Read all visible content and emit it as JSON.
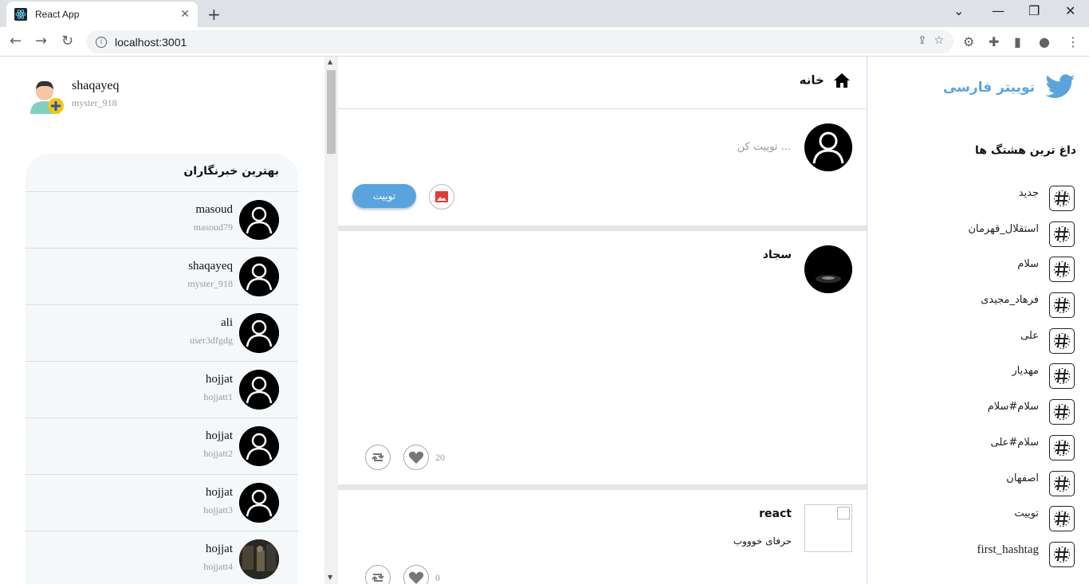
{
  "browser": {
    "tab_title": "React App",
    "url": "localhost:3001"
  },
  "left": {
    "me": {
      "name": "shaqayeq",
      "handle": "myster_918"
    },
    "influencers_title": "بهترین خبرنگاران",
    "influencers": [
      {
        "name": "masoud",
        "handle": "masoud79"
      },
      {
        "name": "shaqayeq",
        "handle": "myster_918"
      },
      {
        "name": "ali",
        "handle": "user3dfgdg"
      },
      {
        "name": "hojjat",
        "handle": "hojjatt1"
      },
      {
        "name": "hojjat",
        "handle": "hojjatt2"
      },
      {
        "name": "hojjat",
        "handle": "hojjatt3"
      },
      {
        "name": "hojjat",
        "handle": "hojjatt4"
      }
    ]
  },
  "center": {
    "home_title": "خانه",
    "compose": {
      "placeholder": "توییت کن ...",
      "tweet_button": "توییت"
    },
    "posts": [
      {
        "author": "سجاد",
        "text": "",
        "likes": "20"
      },
      {
        "author": "react",
        "text": "حرفای خوووب",
        "likes": "0"
      }
    ]
  },
  "right": {
    "brand": "توییتر فارسی",
    "hashtags_title": "داغ ترین هشتگ ها",
    "hashtags": [
      "جدید",
      "استقلال_قهرمان",
      "سلام",
      "فرهاد_مجیدی",
      "علی",
      "مهدیار",
      "سلام#سلام",
      "سلام#علی",
      "اصفهان",
      "توییت",
      "first_hashtag"
    ]
  },
  "colors": {
    "accent": "#59a4de",
    "panel_bg": "#f5f8fa"
  }
}
